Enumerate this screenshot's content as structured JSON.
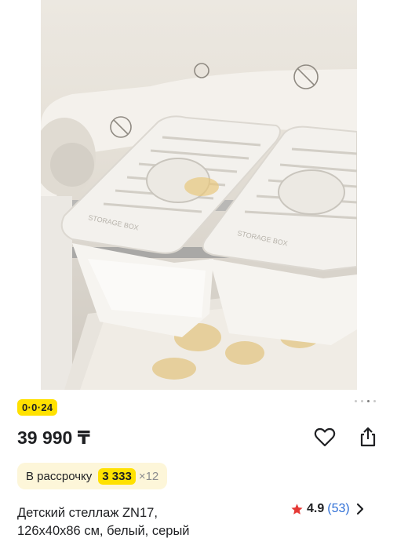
{
  "product": {
    "image_alt": "Storage boxes on shelf",
    "badge": "0·0·24",
    "price": "39 990 ₸",
    "installment": {
      "label": "В рассрочку",
      "amount": "3 333",
      "multiplier": "×12"
    },
    "title_line1": "Детский стеллаж ZN17,",
    "title_line2": "126x40x86 см, белый, серый",
    "rating": {
      "score": "4.9",
      "reviews": "(53)"
    },
    "image_text": "STORAGE BOX"
  },
  "gallery": {
    "dots_total": 4,
    "active_index": 2
  },
  "icons": {
    "favorite": "heart-icon",
    "share": "share-icon",
    "star": "star-icon",
    "chevron": "chevron-right-icon"
  },
  "colors": {
    "accent_yellow": "#ffe100",
    "installment_bg": "#fdf6d9",
    "rating_star": "#e53935",
    "review_link": "#2f6fd6"
  }
}
